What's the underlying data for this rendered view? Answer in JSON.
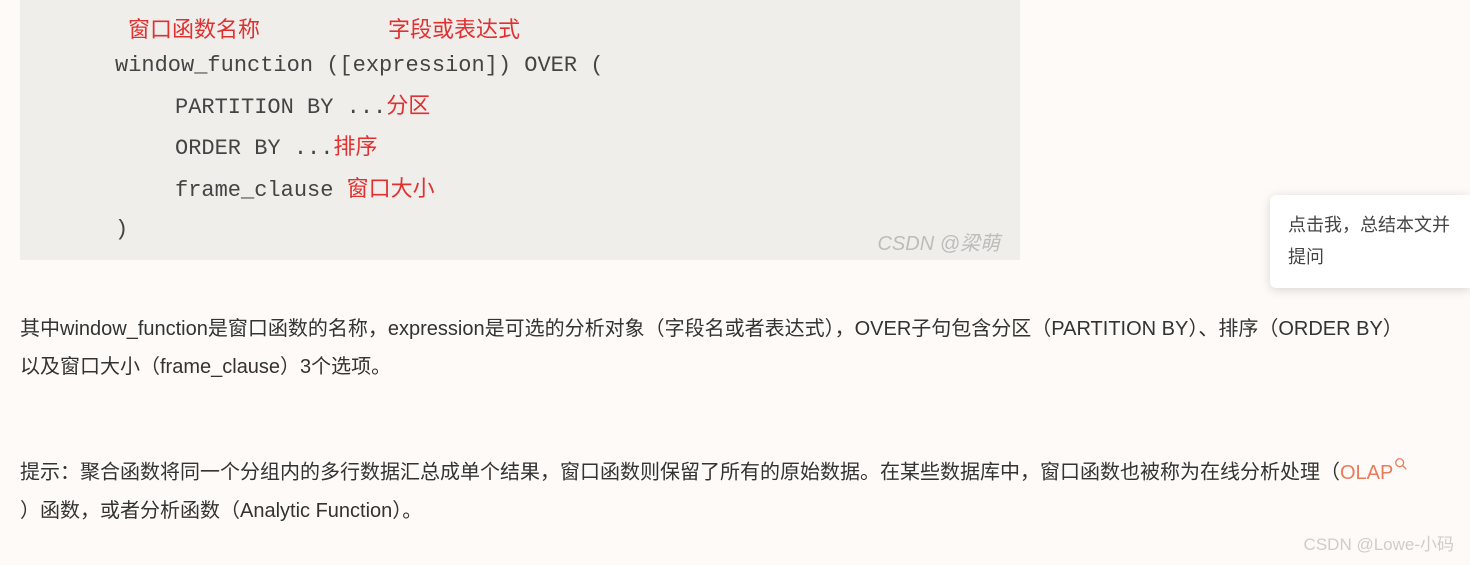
{
  "annotations": {
    "func_name": "窗口函数名称",
    "expression": "字段或表达式",
    "partition": "分区",
    "order": "排序",
    "frame": "窗口大小"
  },
  "code": {
    "line1": "window_function ([expression]) OVER (",
    "line2_prefix": "PARTITION BY ...",
    "line3_prefix": "ORDER BY ...",
    "line4_prefix": "frame_clause ",
    "line5": ")"
  },
  "code_watermark": "CSDN @梁萌",
  "paragraph1": "其中window_function是窗口函数的名称，expression是可选的分析对象（字段名或者表达式），OVER子句包含分区（PARTITION BY）、排序（ORDER BY）以及窗口大小（frame_clause）3个选项。",
  "paragraph2_before": "提示：聚合函数将同一个分组内的多行数据汇总成单个结果，窗口函数则保留了所有的原始数据。在某些数据库中，窗口函数也被称为在线分析处理（",
  "olap_text": "OLAP",
  "paragraph2_after": "）函数，或者分析函数（Analytic Function）。",
  "floating": "点击我，总结本文并提问",
  "page_watermark": "CSDN @Lowe-小码"
}
